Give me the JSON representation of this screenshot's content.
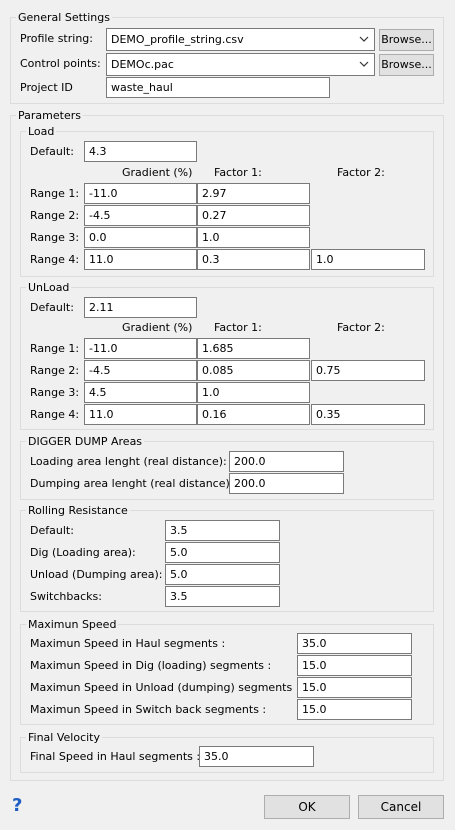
{
  "general": {
    "title": "General Settings",
    "profile_label": "Profile string:",
    "profile_value": "DEMO_profile_string.csv",
    "control_label": "Control points:",
    "control_value": "DEMOc.pac",
    "browse_label": "Browse...",
    "project_label": "Project ID",
    "project_value": "waste_haul"
  },
  "parameters": {
    "title": "Parameters",
    "load": {
      "title": "Load",
      "default_label": "Default:",
      "default_value": "4.3",
      "col_gradient": "Gradient (%)",
      "col_factor1": "Factor 1:",
      "col_factor2": "Factor 2:",
      "rows": [
        {
          "label": "Range 1:",
          "gradient": "-11.0",
          "factor1": "2.97",
          "factor2": null
        },
        {
          "label": "Range 2:",
          "gradient": "-4.5",
          "factor1": "0.27",
          "factor2": null
        },
        {
          "label": "Range 3:",
          "gradient": "0.0",
          "factor1": "1.0",
          "factor2": null
        },
        {
          "label": "Range 4:",
          "gradient": "11.0",
          "factor1": "0.3",
          "factor2": "1.0"
        }
      ]
    },
    "unload": {
      "title": "UnLoad",
      "default_label": "Default:",
      "default_value": "2.11",
      "col_gradient": "Gradient (%)",
      "col_factor1": "Factor 1:",
      "col_factor2": "Factor 2:",
      "rows": [
        {
          "label": "Range 1:",
          "gradient": "-11.0",
          "factor1": "1.685",
          "factor2": null
        },
        {
          "label": "Range 2:",
          "gradient": "-4.5",
          "factor1": "0.085",
          "factor2": "0.75"
        },
        {
          "label": "Range 3:",
          "gradient": "4.5",
          "factor1": "1.0",
          "factor2": null
        },
        {
          "label": "Range 4:",
          "gradient": "11.0",
          "factor1": "0.16",
          "factor2": "0.35"
        }
      ]
    },
    "areas": {
      "title": "DIGGER  DUMP Areas",
      "loading_label": "Loading area lenght (real distance):",
      "loading_value": "200.0",
      "dumping_label": "Dumping area lenght (real distance):",
      "dumping_value": "200.0"
    },
    "rolling": {
      "title": "Rolling Resistance",
      "default_label": "Default:",
      "default_value": "3.5",
      "dig_label": "Dig (Loading area):",
      "dig_value": "5.0",
      "unload_label": "Unload (Dumping area):",
      "unload_value": "5.0",
      "switch_label": "Switchbacks:",
      "switch_value": "3.5"
    },
    "speed": {
      "title": "Maximun Speed",
      "haul_label": "Maximun Speed in Haul segments :",
      "haul_value": "35.0",
      "dig_label": "Maximun Speed in Dig (loading) segments :",
      "dig_value": "15.0",
      "unload_label": "Maximun Speed in Unload (dumping) segments :",
      "unload_value": "15.0",
      "switch_label": "Maximun Speed in Switch back segments  :",
      "switch_value": "15.0"
    },
    "final": {
      "title": "Final Velocity",
      "haul_label": "Final Speed in Haul segments :",
      "haul_value": "35.0"
    }
  },
  "buttons": {
    "help": "?",
    "ok": "OK",
    "cancel": "Cancel"
  }
}
